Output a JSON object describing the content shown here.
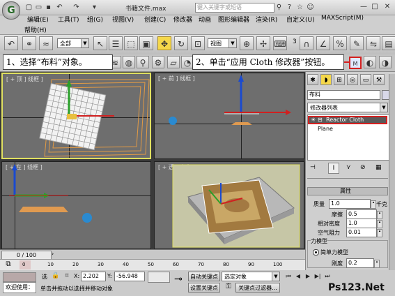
{
  "window": {
    "title": "书籍文件.max",
    "search_placeholder": "键入关键字或短语",
    "minimize": "—",
    "maximize": "□",
    "close": "✕"
  },
  "menu": [
    "编辑(E)",
    "工具(T)",
    "组(G)",
    "视图(V)",
    "创建(C)",
    "修改器",
    "动画",
    "图形编辑器",
    "渲染(R)",
    "自定义(U)",
    "MAXScript(M)",
    "帮助(H)"
  ],
  "toolbar": {
    "selection_filter": "全部",
    "reference_coord": "视图",
    "snap_value": "3"
  },
  "callouts": {
    "step1": "1、选择“布料”对象。",
    "step2": "2、单击“应用 Cloth 修改器”按钮。"
  },
  "viewports": {
    "top": "[ + 顶 ] 线框 ]",
    "front": "[ + 前 ] 线框 ]",
    "left": "[ + 左 ] 线框 ]",
    "perspective": "[ + 透 ] 真实 ]"
  },
  "panel": {
    "object_name": "布料",
    "modifier_list": "修改器列表",
    "stack": [
      "Reactor Cloth",
      "Plane"
    ],
    "rollout_title": "属性",
    "mass_label": "质量",
    "mass_value": "1.0",
    "mass_unit": "千克",
    "friction_label": "摩擦",
    "friction_value": "0.5",
    "relative_density_label": "相对密度",
    "relative_density_value": "1.0",
    "air_resistance_label": "空气阻力",
    "air_resistance_value": "0.01",
    "force_model_label": "力模型",
    "simple_force_label": "简单力模型",
    "stiffness_label": "刚度",
    "stiffness_value": "0.2"
  },
  "timeline": {
    "frame": "0 / 100",
    "ticks": [
      "0",
      "10",
      "20",
      "30",
      "40",
      "50",
      "60",
      "70",
      "80",
      "90",
      "100"
    ]
  },
  "status": {
    "welcome": "欢迎使用：",
    "selected_label": "选",
    "x_label": "X:",
    "x_value": "2.202",
    "y_label": "Y:",
    "y_value": "-56.948",
    "auto_key": "自动关键点",
    "selected_object": "选定对象",
    "set_key": "设置关键点",
    "key_filters": "关键点过滤器...",
    "prompt": "单击并拖动以选择并移动对象",
    "watermark": "Ps123.Net"
  },
  "colors": {
    "selected_border": "#e0e060",
    "highlight_red": "#d42020",
    "active_button": "#f5d84a"
  }
}
